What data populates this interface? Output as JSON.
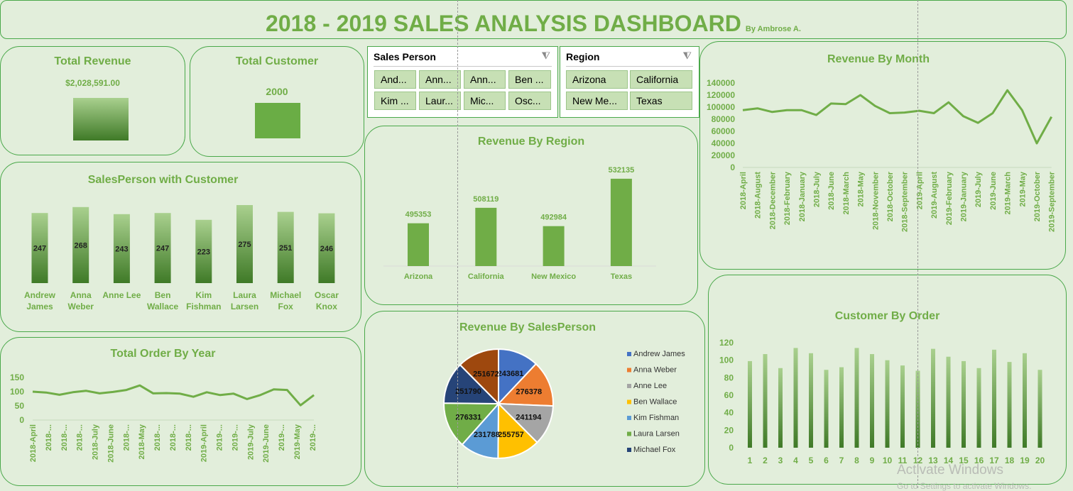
{
  "header": {
    "title": "2018 - 2019 SALES ANALYSIS DASHBOARD",
    "byline": "By Ambrose A."
  },
  "total_revenue": {
    "title": "Total Revenue",
    "value": "$2,028,591.00"
  },
  "total_customer": {
    "title": "Total Customer",
    "value": "2000"
  },
  "slicers": {
    "sales_person": {
      "header": "Sales Person",
      "items": [
        "And...",
        "Ann...",
        "Ann...",
        "Ben ...",
        "Kim ...",
        "Laur...",
        "Mic...",
        "Osc..."
      ]
    },
    "region": {
      "header": "Region",
      "items": [
        "Arizona",
        "California",
        "New Me...",
        "Texas"
      ]
    }
  },
  "panels": {
    "salesperson_customer": "SalesPerson with Customer",
    "revenue_region": "Revenue By Region",
    "revenue_month": "Revenue By Month",
    "total_order_year": "Total Order By Year",
    "revenue_salesperson": "Revenue By SalesPerson",
    "customer_order": "Customer By Order"
  },
  "watermark": {
    "line1": "Activate Windows",
    "line2": "Go to Settings to activate Windows."
  },
  "colors": {
    "accent": "#70ad47",
    "bar_dark": "#3f7a27",
    "bar_light": "#a9d08e",
    "border": "#4aa84a"
  },
  "chart_data": [
    {
      "id": "salesperson_customer",
      "type": "bar",
      "categories": [
        "Andrew James",
        "Anna Weber",
        "Anne Lee",
        "Ben Wallace",
        "Kim Fishman",
        "Laura Larsen",
        "Michael Fox",
        "Oscar Knox"
      ],
      "category_lines": [
        [
          "Andrew",
          "James"
        ],
        [
          "Anna",
          "Weber"
        ],
        [
          "Anne Lee"
        ],
        [
          "Ben",
          "Wallace"
        ],
        [
          "Kim",
          "Fishman"
        ],
        [
          "Laura",
          "Larsen"
        ],
        [
          "Michael",
          "Fox"
        ],
        [
          "Oscar",
          "Knox"
        ]
      ],
      "values": [
        247,
        268,
        243,
        247,
        223,
        275,
        251,
        246
      ],
      "value_labels": [
        "247",
        "268",
        "243",
        "247",
        "223",
        "275",
        "251",
        "246"
      ],
      "ylim": [
        0,
        280
      ]
    },
    {
      "id": "revenue_region",
      "type": "bar",
      "categories": [
        "Arizona",
        "California",
        "New Mexico",
        "Texas"
      ],
      "values": [
        495353,
        508119,
        492984,
        532135
      ],
      "value_labels": [
        "495353",
        "508119",
        "492984",
        "532135"
      ],
      "ylim": [
        460000,
        535000
      ]
    },
    {
      "id": "revenue_month",
      "type": "line",
      "categories": [
        "2018-April",
        "2018-August",
        "2018-December",
        "2018-February",
        "2018-January",
        "2018-July",
        "2018-June",
        "2018-March",
        "2018-May",
        "2018-November",
        "2018-October",
        "2018-September",
        "2019-April",
        "2019-August",
        "2019-February",
        "2019-January",
        "2019-July",
        "2019-June",
        "2019-March",
        "2019-May",
        "2019-October",
        "2019-September"
      ],
      "values": [
        95000,
        98000,
        92000,
        95000,
        95000,
        87000,
        106000,
        105000,
        120000,
        102000,
        90000,
        91000,
        94000,
        90000,
        108000,
        85000,
        74000,
        90000,
        128000,
        95000,
        40000,
        84000
      ],
      "ylim": [
        0,
        140000
      ],
      "yticks": [
        "140000",
        "120000",
        "100000",
        "80000",
        "60000",
        "40000",
        "20000",
        "0"
      ]
    },
    {
      "id": "total_order_year",
      "type": "line",
      "categories": [
        "2018-April",
        "2018-...",
        "2018-...",
        "2018-...",
        "2018-July",
        "2018-June",
        "2018-...",
        "2018-May",
        "2018-...",
        "2018-...",
        "2018-...",
        "2019-April",
        "2019-...",
        "2019-...",
        "2019-July",
        "2019-June",
        "2019-...",
        "2019-May",
        "2019-..."
      ],
      "values": [
        100,
        97,
        89,
        98,
        103,
        94,
        99,
        106,
        122,
        94,
        95,
        93,
        82,
        98,
        88,
        93,
        74,
        88,
        108,
        106,
        52,
        88
      ],
      "ylim": [
        0,
        150
      ],
      "yticks": [
        "150",
        "100",
        "50",
        "0"
      ]
    },
    {
      "id": "revenue_salesperson",
      "type": "pie",
      "series": [
        "Andrew James",
        "Anna Weber",
        "Anne Lee",
        "Ben Wallace",
        "Kim Fishman",
        "Laura Larsen",
        "Michael Fox",
        "Oscar Knox"
      ],
      "values": [
        243681,
        276378,
        241194,
        255757,
        231788,
        276331,
        251790,
        251672
      ],
      "value_labels": [
        "243681",
        "276378",
        "241194",
        "255757",
        "231788",
        "276331",
        "251790",
        "251672"
      ],
      "legend_labels": [
        "Andrew James",
        "Anna Weber",
        "Anne Lee",
        "Ben Wallace",
        "Kim Fishman",
        "Laura Larsen",
        "Michael Fox"
      ],
      "colors": [
        "#4472c4",
        "#ed7d31",
        "#a5a5a5",
        "#ffc000",
        "#5b9bd5",
        "#70ad47",
        "#264478",
        "#9e480e"
      ],
      "legend": "right"
    },
    {
      "id": "customer_order",
      "type": "bar",
      "categories": [
        "1",
        "2",
        "3",
        "4",
        "5",
        "6",
        "7",
        "8",
        "9",
        "10",
        "11",
        "12",
        "13",
        "14",
        "15",
        "16",
        "17",
        "18",
        "19",
        "20"
      ],
      "values": [
        99,
        107,
        91,
        114,
        108,
        89,
        92,
        114,
        107,
        100,
        94,
        88,
        113,
        104,
        99,
        91,
        112,
        98,
        108,
        89
      ],
      "ylim": [
        0,
        120
      ],
      "yticks": [
        "120",
        "100",
        "80",
        "60",
        "40",
        "20",
        "0"
      ]
    }
  ]
}
